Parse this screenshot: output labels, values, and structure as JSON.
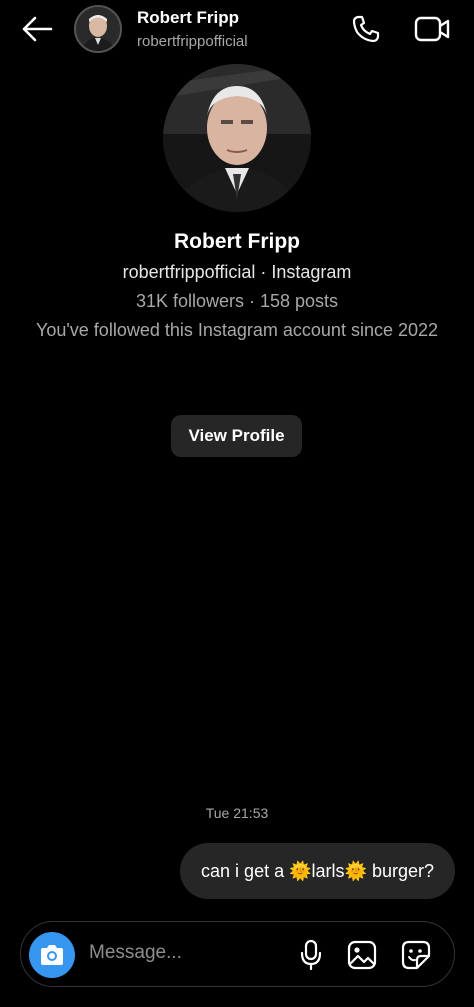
{
  "header": {
    "name": "Robert Fripp",
    "username": "robertfrippofficial",
    "back_icon": "arrow-left-icon",
    "call_icon": "phone-icon",
    "video_icon": "video-camera-icon"
  },
  "profile": {
    "name": "Robert Fripp",
    "subtitle": "robertfrippofficial · Instagram",
    "stats": "31K followers · 158 posts",
    "followed_since": "You've followed this Instagram account since 2022",
    "view_profile_label": "View Profile"
  },
  "conversation": {
    "timestamp": "Tue 21:53",
    "messages": [
      {
        "sender": "me",
        "parts": [
          "can i get a ",
          "🌞",
          "larls",
          "🌞",
          " burger?"
        ]
      }
    ]
  },
  "composer": {
    "placeholder": "Message...",
    "camera_icon": "camera-icon",
    "mic_icon": "microphone-icon",
    "gallery_icon": "image-icon",
    "sticker_icon": "sticker-icon"
  },
  "colors": {
    "background": "#000000",
    "accent": "#3797f0",
    "bubble": "#262626",
    "secondary_text": "#a8a8a8"
  }
}
